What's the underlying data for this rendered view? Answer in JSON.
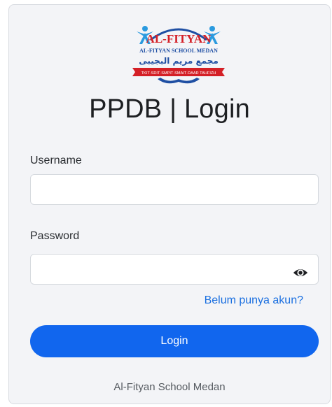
{
  "logo": {
    "name_text": "AL-FITYAN",
    "subtitle_text": "AL-FITYAN SCHOOL MEDAN",
    "arabic_text": "مجمع مريم البجيبى",
    "ribbon_text": "TKIT·SDIT·SMPIT·SMAIT·DAAR TAHFIZH"
  },
  "page_title": "PPDB | Login",
  "form": {
    "username_label": "Username",
    "username_value": "",
    "password_label": "Password",
    "password_value": "",
    "signup_link": "Belum punya akun?",
    "login_button": "Login"
  },
  "footer": "Al-Fityan School Medan",
  "colors": {
    "primary": "#1166ee",
    "link": "#1a6fe0",
    "card_bg": "#f3f4f7",
    "logo_blue": "#1f4fa3",
    "logo_red": "#d41f26"
  },
  "icons": {
    "password_toggle": "eye-icon"
  }
}
